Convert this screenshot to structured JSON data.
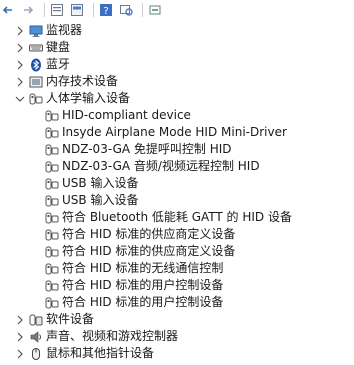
{
  "device_manager": {
    "categories_above": [
      {
        "label": "监视器",
        "icon": "monitor-icon"
      },
      {
        "label": "键盘",
        "icon": "keyboard-icon"
      },
      {
        "label": "蓝牙",
        "icon": "bluetooth-icon"
      },
      {
        "label": "内存技术设备",
        "icon": "memory-device-icon"
      }
    ],
    "expanded_category": {
      "label": "人体学输入设备",
      "icon": "hid-icon"
    },
    "hid_devices": [
      "HID-compliant device",
      "Insyde Airplane Mode HID Mini-Driver",
      "NDZ-03-GA 免提呼叫控制 HID",
      "NDZ-03-GA 音频/视频远程控制 HID",
      "USB 输入设备",
      "USB 输入设备",
      "符合 Bluetooth 低能耗 GATT 的 HID 设备",
      "符合 HID 标准的供应商定义设备",
      "符合 HID 标准的供应商定义设备",
      "符合 HID 标准的无线通信控制",
      "符合 HID 标准的用户控制设备",
      "符合 HID 标准的用户控制设备"
    ],
    "categories_below": [
      {
        "label": "软件设备",
        "icon": "software-device-icon"
      },
      {
        "label": "声音、视频和游戏控制器",
        "icon": "sound-icon"
      },
      {
        "label": "鼠标和其他指针设备",
        "icon": "mouse-icon"
      }
    ]
  }
}
